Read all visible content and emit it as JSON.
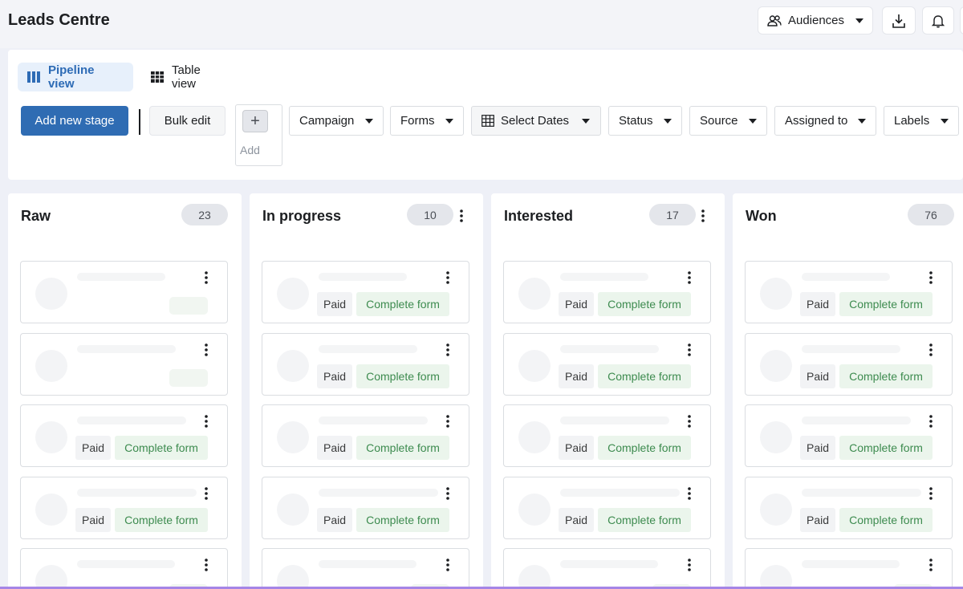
{
  "header": {
    "title": "Leads Centre",
    "audiences_label": "Audiences",
    "icons": [
      "users-icon",
      "download-icon",
      "bell-icon"
    ]
  },
  "views": {
    "pipeline_label": "Pipeline view",
    "table_label": "Table view",
    "active": "Pipeline view"
  },
  "toolbar": {
    "add_stage_label": "Add new stage",
    "bulk_edit_label": "Bulk edit",
    "add_plus": "+",
    "add_label": "Add"
  },
  "filters": [
    "Campaign",
    "Forms",
    "Select Dates",
    "Status",
    "Source",
    "Assigned to",
    "Labels"
  ],
  "tags": {
    "paid": "Paid",
    "form": "Complete form"
  },
  "columns": [
    {
      "title": "Raw",
      "count": "23"
    },
    {
      "title": "In progress",
      "count": "10"
    },
    {
      "title": "Interested",
      "count": "17"
    },
    {
      "title": "Won",
      "count": "76"
    }
  ],
  "colors": {
    "primary": "#2f6cb3",
    "pipeline_active_bg": "#e7f0fb",
    "form_tag_text": "#3d8b4f",
    "form_tag_bg": "#ebf5ec",
    "bottom_accent": "#a585e6"
  }
}
